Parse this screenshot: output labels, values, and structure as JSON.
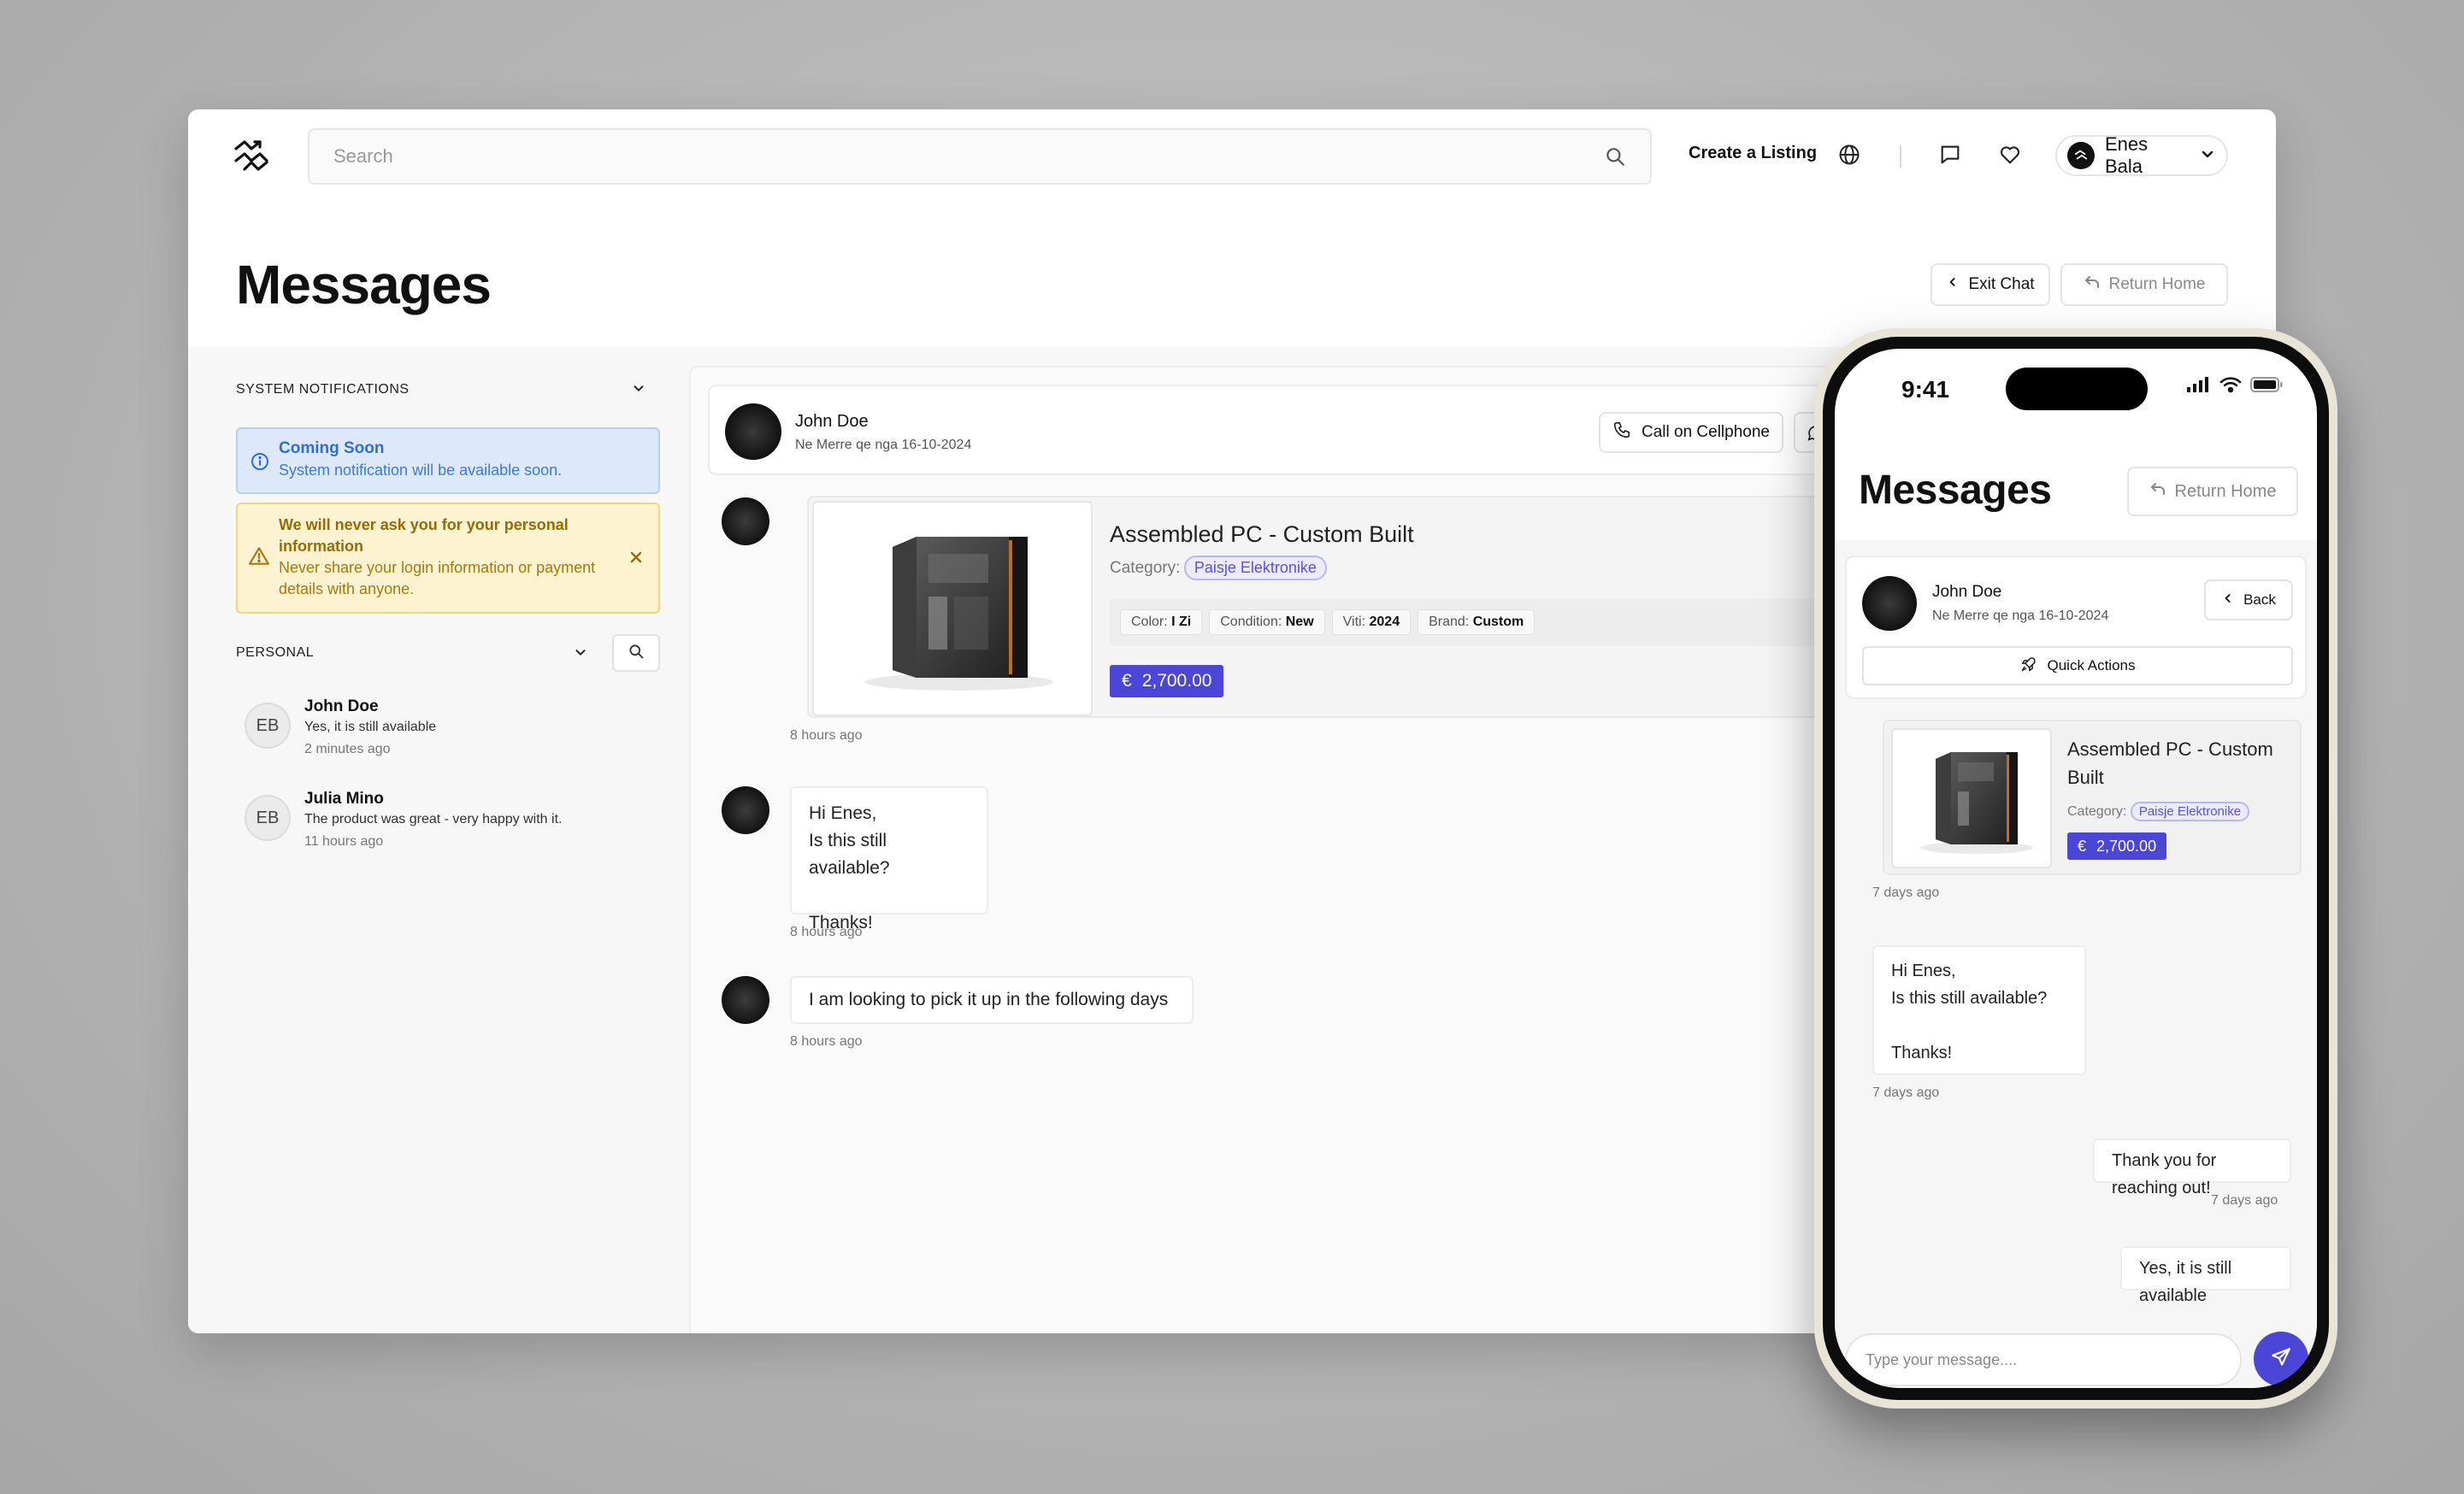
{
  "header": {
    "search_placeholder": "Search",
    "create_listing": "Create a Listing",
    "user_name": "Enes Bala"
  },
  "page": {
    "title": "Messages",
    "exit_chat": "Exit Chat",
    "return_home": "Return Home"
  },
  "sidebar": {
    "system_section": "SYSTEM NOTIFICATIONS",
    "info_alert": {
      "title": "Coming Soon",
      "desc": "System notification will be available soon."
    },
    "warning_alert": {
      "title": "We will never ask you for your personal information",
      "desc": "Never share your login information or payment details with anyone."
    },
    "personal_section": "PERSONAL",
    "conversations": [
      {
        "initials": "EB",
        "name": "John Doe",
        "preview": "Yes, it is still available",
        "time": "2 minutes ago"
      },
      {
        "initials": "EB",
        "name": "Julia Mino",
        "preview": "The product was great - very happy with it.",
        "time": "11 hours ago"
      }
    ]
  },
  "chat": {
    "contact_name": "John Doe",
    "member_since": "Ne Merre qe nga 16-10-2024",
    "call_button": "Call on Cellphone",
    "product": {
      "title": "Assembled PC - Custom Built",
      "category_label": "Category:",
      "category": "Paisje Elektronike",
      "attributes": [
        {
          "label": "Color:",
          "value": "I Zi"
        },
        {
          "label": "Condition:",
          "value": "New"
        },
        {
          "label": "Viti:",
          "value": "2024"
        },
        {
          "label": "Brand:",
          "value": "Custom"
        }
      ],
      "currency": "€",
      "price": "2,700.00",
      "time": "8 hours ago"
    },
    "messages": [
      {
        "text": "Hi Enes,\nIs this still available?\n\nThanks!",
        "time": "8 hours ago"
      },
      {
        "text": "I am looking to pick it up in the following days",
        "time": "8 hours ago"
      }
    ],
    "input_placeholder": "Type your message...."
  },
  "phone": {
    "status_time": "9:41",
    "title": "Messages",
    "return_home": "Return Home",
    "contact_name": "John Doe",
    "member_since": "Ne Merre qe nga 16-10-2024",
    "back": "Back",
    "quick_actions": "Quick Actions",
    "product": {
      "title": "Assembled PC - Custom Built",
      "category_label": "Category:",
      "category": "Paisje Elektronike",
      "currency": "€",
      "price": "2,700.00",
      "time": "7 days ago"
    },
    "messages": [
      {
        "text": "Hi Enes,\nIs this still available?\n\nThanks!",
        "time": "7 days ago",
        "side": "left"
      },
      {
        "text": "Thank you for reaching out!",
        "time": "7 days ago",
        "side": "right"
      },
      {
        "text": "Yes, it is still available",
        "time": "",
        "side": "right"
      }
    ],
    "input_placeholder": "Type your message...."
  },
  "colors": {
    "accent": "#4b45d8",
    "info_bg": "#dde9fb",
    "warning_bg": "#fdf3d0"
  }
}
